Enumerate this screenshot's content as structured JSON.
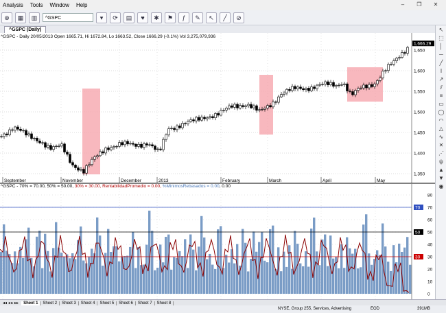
{
  "menu": {
    "items": [
      "Analysis",
      "Tools",
      "Window",
      "Help"
    ]
  },
  "toolbar": {
    "symbol": "^GSPC"
  },
  "document_tab": {
    "label": "^GSPC (Daily)"
  },
  "price_pane": {
    "header": "^GSPC - Daily 20/05/2013 Open 1665.71, Hi 1672.84, Lo 1663.52, Close 1666.29 (-0.1%) Vol 3,275,079,936",
    "last_price_label": "1,666.29",
    "y_ticks": [
      "1,650",
      "1,600",
      "1,550",
      "1,500",
      "1,450",
      "1,400",
      "1,350"
    ],
    "x_ticks": [
      "September",
      "November",
      "December",
      "2013",
      "February",
      "March",
      "April",
      "May"
    ]
  },
  "indicator_pane": {
    "header_parts": [
      {
        "text": "^GSPC - 70% = 70.00, 50% = 50.00, ",
        "color": "#000000"
      },
      {
        "text": "30% = 30.00, RentabilidadPromedio = 0.00, ",
        "color": "#b00000"
      },
      {
        "text": "%MinimosRebasados = 0.00",
        "color": "#4a78b8"
      },
      {
        "text": ", 0.00",
        "color": "#000000"
      }
    ],
    "y_ticks": [
      "80",
      "70",
      "60",
      "50",
      "40",
      "30",
      "20",
      "10",
      "0"
    ],
    "level_badges": [
      "70",
      "50",
      "30"
    ]
  },
  "sheets": [
    "Sheet 1",
    "Sheet 2",
    "Sheet 3",
    "Sheet 4",
    "Sheet 5",
    "Sheet 6",
    "Sheet 7",
    "Sheet 8"
  ],
  "status": {
    "exchange_info": "NYSE, Group 255, Services, Advertising",
    "eod": "EOD",
    "memory": "391MB"
  },
  "colors": {
    "candle_up": "#ffffff",
    "candle_down": "#000000",
    "highlight": "#f5a0a8",
    "volume_bar": "#7a9cc6",
    "avg_return_line": "#8b0000",
    "level_70": "#3050c0",
    "level_50": "#000000",
    "level_30": "#cc0000"
  }
}
